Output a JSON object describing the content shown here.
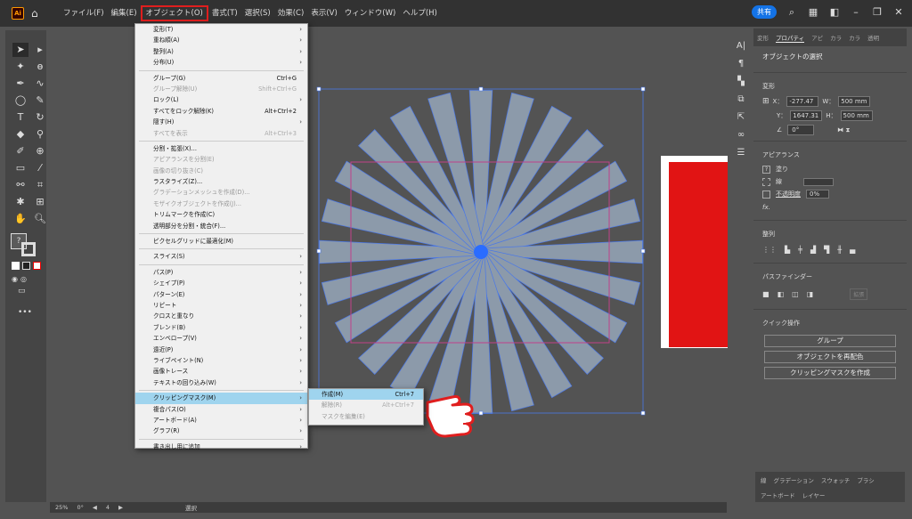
{
  "menubar": {
    "logo": "Ai",
    "items": [
      "ファイル(F)",
      "編集(E)",
      "オブジェクト(O)",
      "書式(T)",
      "選択(S)",
      "効果(C)",
      "表示(V)",
      "ウィンドウ(W)",
      "ヘルプ(H)"
    ],
    "share": "共有"
  },
  "object_menu": {
    "items": [
      {
        "label": "変形(T)",
        "arrow": true
      },
      {
        "label": "重ね順(A)",
        "arrow": true
      },
      {
        "label": "整列(A)",
        "arrow": true
      },
      {
        "label": "分布(U)",
        "arrow": true
      },
      {
        "sep": true
      },
      {
        "label": "グループ(G)",
        "shortcut": "Ctrl+G"
      },
      {
        "label": "グループ解除(U)",
        "shortcut": "Shift+Ctrl+G",
        "disabled": true
      },
      {
        "label": "ロック(L)",
        "arrow": true
      },
      {
        "label": "すべてをロック解除(K)",
        "shortcut": "Alt+Ctrl+2"
      },
      {
        "label": "隠す(H)",
        "arrow": true
      },
      {
        "label": "すべてを表示",
        "shortcut": "Alt+Ctrl+3",
        "disabled": true
      },
      {
        "sep": true
      },
      {
        "label": "分割・拡張(X)..."
      },
      {
        "label": "アピアランスを分割(E)",
        "disabled": true
      },
      {
        "label": "画像の切り抜き(C)",
        "disabled": true
      },
      {
        "label": "ラスタライズ(Z)..."
      },
      {
        "label": "グラデーションメッシュを作成(D)...",
        "disabled": true
      },
      {
        "label": "モザイクオブジェクトを作成(J)...",
        "disabled": true
      },
      {
        "label": "トリムマークを作成(C)"
      },
      {
        "label": "透明部分を分割・統合(F)..."
      },
      {
        "sep": true
      },
      {
        "label": "ピクセルグリッドに最適化(M)"
      },
      {
        "sep": true
      },
      {
        "label": "スライス(S)",
        "arrow": true
      },
      {
        "sep": true
      },
      {
        "label": "パス(P)",
        "arrow": true
      },
      {
        "label": "シェイプ(P)",
        "arrow": true
      },
      {
        "label": "パターン(E)",
        "arrow": true
      },
      {
        "label": "リピート",
        "arrow": true
      },
      {
        "label": "クロスと重なり",
        "arrow": true
      },
      {
        "label": "ブレンド(B)",
        "arrow": true
      },
      {
        "label": "エンベロープ(V)",
        "arrow": true
      },
      {
        "label": "遠近(P)",
        "arrow": true
      },
      {
        "label": "ライブペイント(N)",
        "arrow": true
      },
      {
        "label": "画像トレース",
        "arrow": true
      },
      {
        "label": "テキストの回り込み(W)",
        "arrow": true
      },
      {
        "sep": true
      },
      {
        "label": "クリッピングマスク(M)",
        "arrow": true,
        "highlight": true
      },
      {
        "label": "複合パス(O)",
        "arrow": true
      },
      {
        "label": "アートボード(A)",
        "arrow": true
      },
      {
        "label": "グラフ(R)",
        "arrow": true
      },
      {
        "sep": true
      },
      {
        "label": "書き出し用に追加",
        "arrow": true
      }
    ]
  },
  "submenu": {
    "items": [
      {
        "label": "作成(M)",
        "shortcut": "Ctrl+7",
        "highlight": true
      },
      {
        "label": "解除(R)",
        "shortcut": "Alt+Ctrl+7",
        "disabled": true
      },
      {
        "label": "マスクを編集(E)",
        "disabled": true
      }
    ]
  },
  "right_panel": {
    "tabs": [
      "変形",
      "プロパティ",
      "アピ",
      "カラ",
      "カラ",
      "透明"
    ],
    "section_title": "オブジェクトの選択",
    "transform": {
      "heading": "変形",
      "x_label": "X：",
      "x_value": "-277.47",
      "w_label": "W：",
      "w_value": "500 mm",
      "y_label": "Y：",
      "y_value": "1647.31",
      "h_label": "H：",
      "h_value": "500 mm",
      "angle_value": "0°"
    },
    "appearance": {
      "heading": "アピアランス",
      "fill_label": "塗り",
      "stroke_label": "線",
      "opacity_label": "不透明度",
      "opacity_value": "0%",
      "fx_label": "fx."
    },
    "align_heading": "整列",
    "pathfinder_heading": "パスファインダー",
    "pathfinder_more": "拡張",
    "quick_actions": {
      "heading": "クイック操作",
      "buttons": [
        "グループ",
        "オブジェクトを再配色",
        "クリッピングマスクを作成"
      ]
    },
    "bottom_tabs_1": [
      "線",
      "グラデーション",
      "スウォッチ",
      "ブラシ"
    ],
    "bottom_tabs_2": [
      "アートボード",
      "レイヤー"
    ]
  },
  "status_bar": {
    "zoom": "25%",
    "rotation": "0°",
    "artboard": "4",
    "tool": "選択"
  },
  "colors": {
    "highlight": "#9fd4ee",
    "selection_outline": "#4a78e8",
    "starburst": "#8c9aaa",
    "red_rect": "#e11414",
    "active_menu_border": "#e01e1e"
  }
}
